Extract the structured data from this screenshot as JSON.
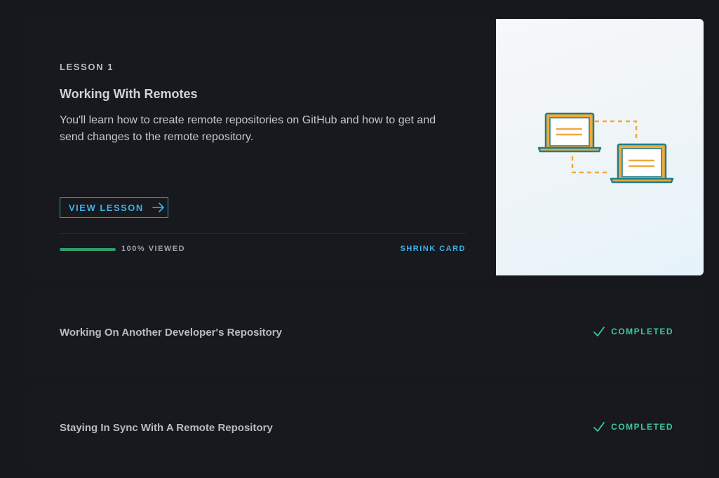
{
  "lesson": {
    "label": "LESSON 1",
    "title": "Working With Remotes",
    "description": "You'll learn how to create remote repositories on GitHub and how to get and send changes to the remote repository.",
    "view_button": "VIEW LESSON",
    "progress_percent": 100,
    "progress_text": "100% VIEWED",
    "shrink_button": "SHRINK CARD"
  },
  "rows": [
    {
      "title": "Working On Another Developer's Repository",
      "status": "COMPLETED"
    },
    {
      "title": "Staying In Sync With A Remote Repository",
      "status": "COMPLETED"
    }
  ],
  "colors": {
    "accent_blue": "#3cb2e6",
    "progress_green": "#2e9e6a",
    "completed_teal": "#3dc7a6",
    "illustration_teal": "#1f7f8c",
    "illustration_orange": "#f2a93b"
  },
  "icons": {
    "view_button_icon": "arrow-right-icon",
    "completed_icon": "checkmark-icon",
    "illustration": "two-laptops-sync-illustration"
  }
}
